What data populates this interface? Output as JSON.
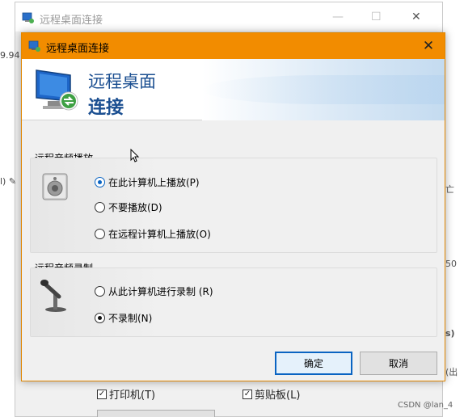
{
  "background_window": {
    "title": "远程桌面连接",
    "left_edge_texts": [
      "9.94",
      "l) ✎"
    ],
    "right_edge_texts": [
      "亡",
      "50",
      "s)",
      "(出"
    ],
    "checkboxes": [
      {
        "label": "打印机(T)",
        "checked": true
      },
      {
        "label": "剪贴板(L)",
        "checked": true
      }
    ],
    "minimize_label": "—",
    "maximize_label": "☐",
    "close_label": "✕"
  },
  "dialog": {
    "title": "远程桌面连接",
    "close_label": "✕",
    "banner": {
      "line1": "远程桌面",
      "line2": "连接"
    },
    "playback_group": {
      "title": "远程音频播放",
      "options": [
        {
          "label": "在此计算机上播放(P)",
          "selected": true
        },
        {
          "label": "不要播放(D)",
          "selected": false
        },
        {
          "label": "在远程计算机上播放(O)",
          "selected": false
        }
      ]
    },
    "recording_group": {
      "title": "远程音频录制",
      "options": [
        {
          "label": "从此计算机进行录制 (R)",
          "selected": false
        },
        {
          "label": "不录制(N)",
          "selected": true
        }
      ]
    },
    "ok_label": "确定",
    "cancel_label": "取消"
  },
  "watermark": "CSDN @lan_4",
  "colors": {
    "titlebar": "#f28c00",
    "banner_text": "#1b4f91",
    "focus_blue": "#0a64c2"
  }
}
